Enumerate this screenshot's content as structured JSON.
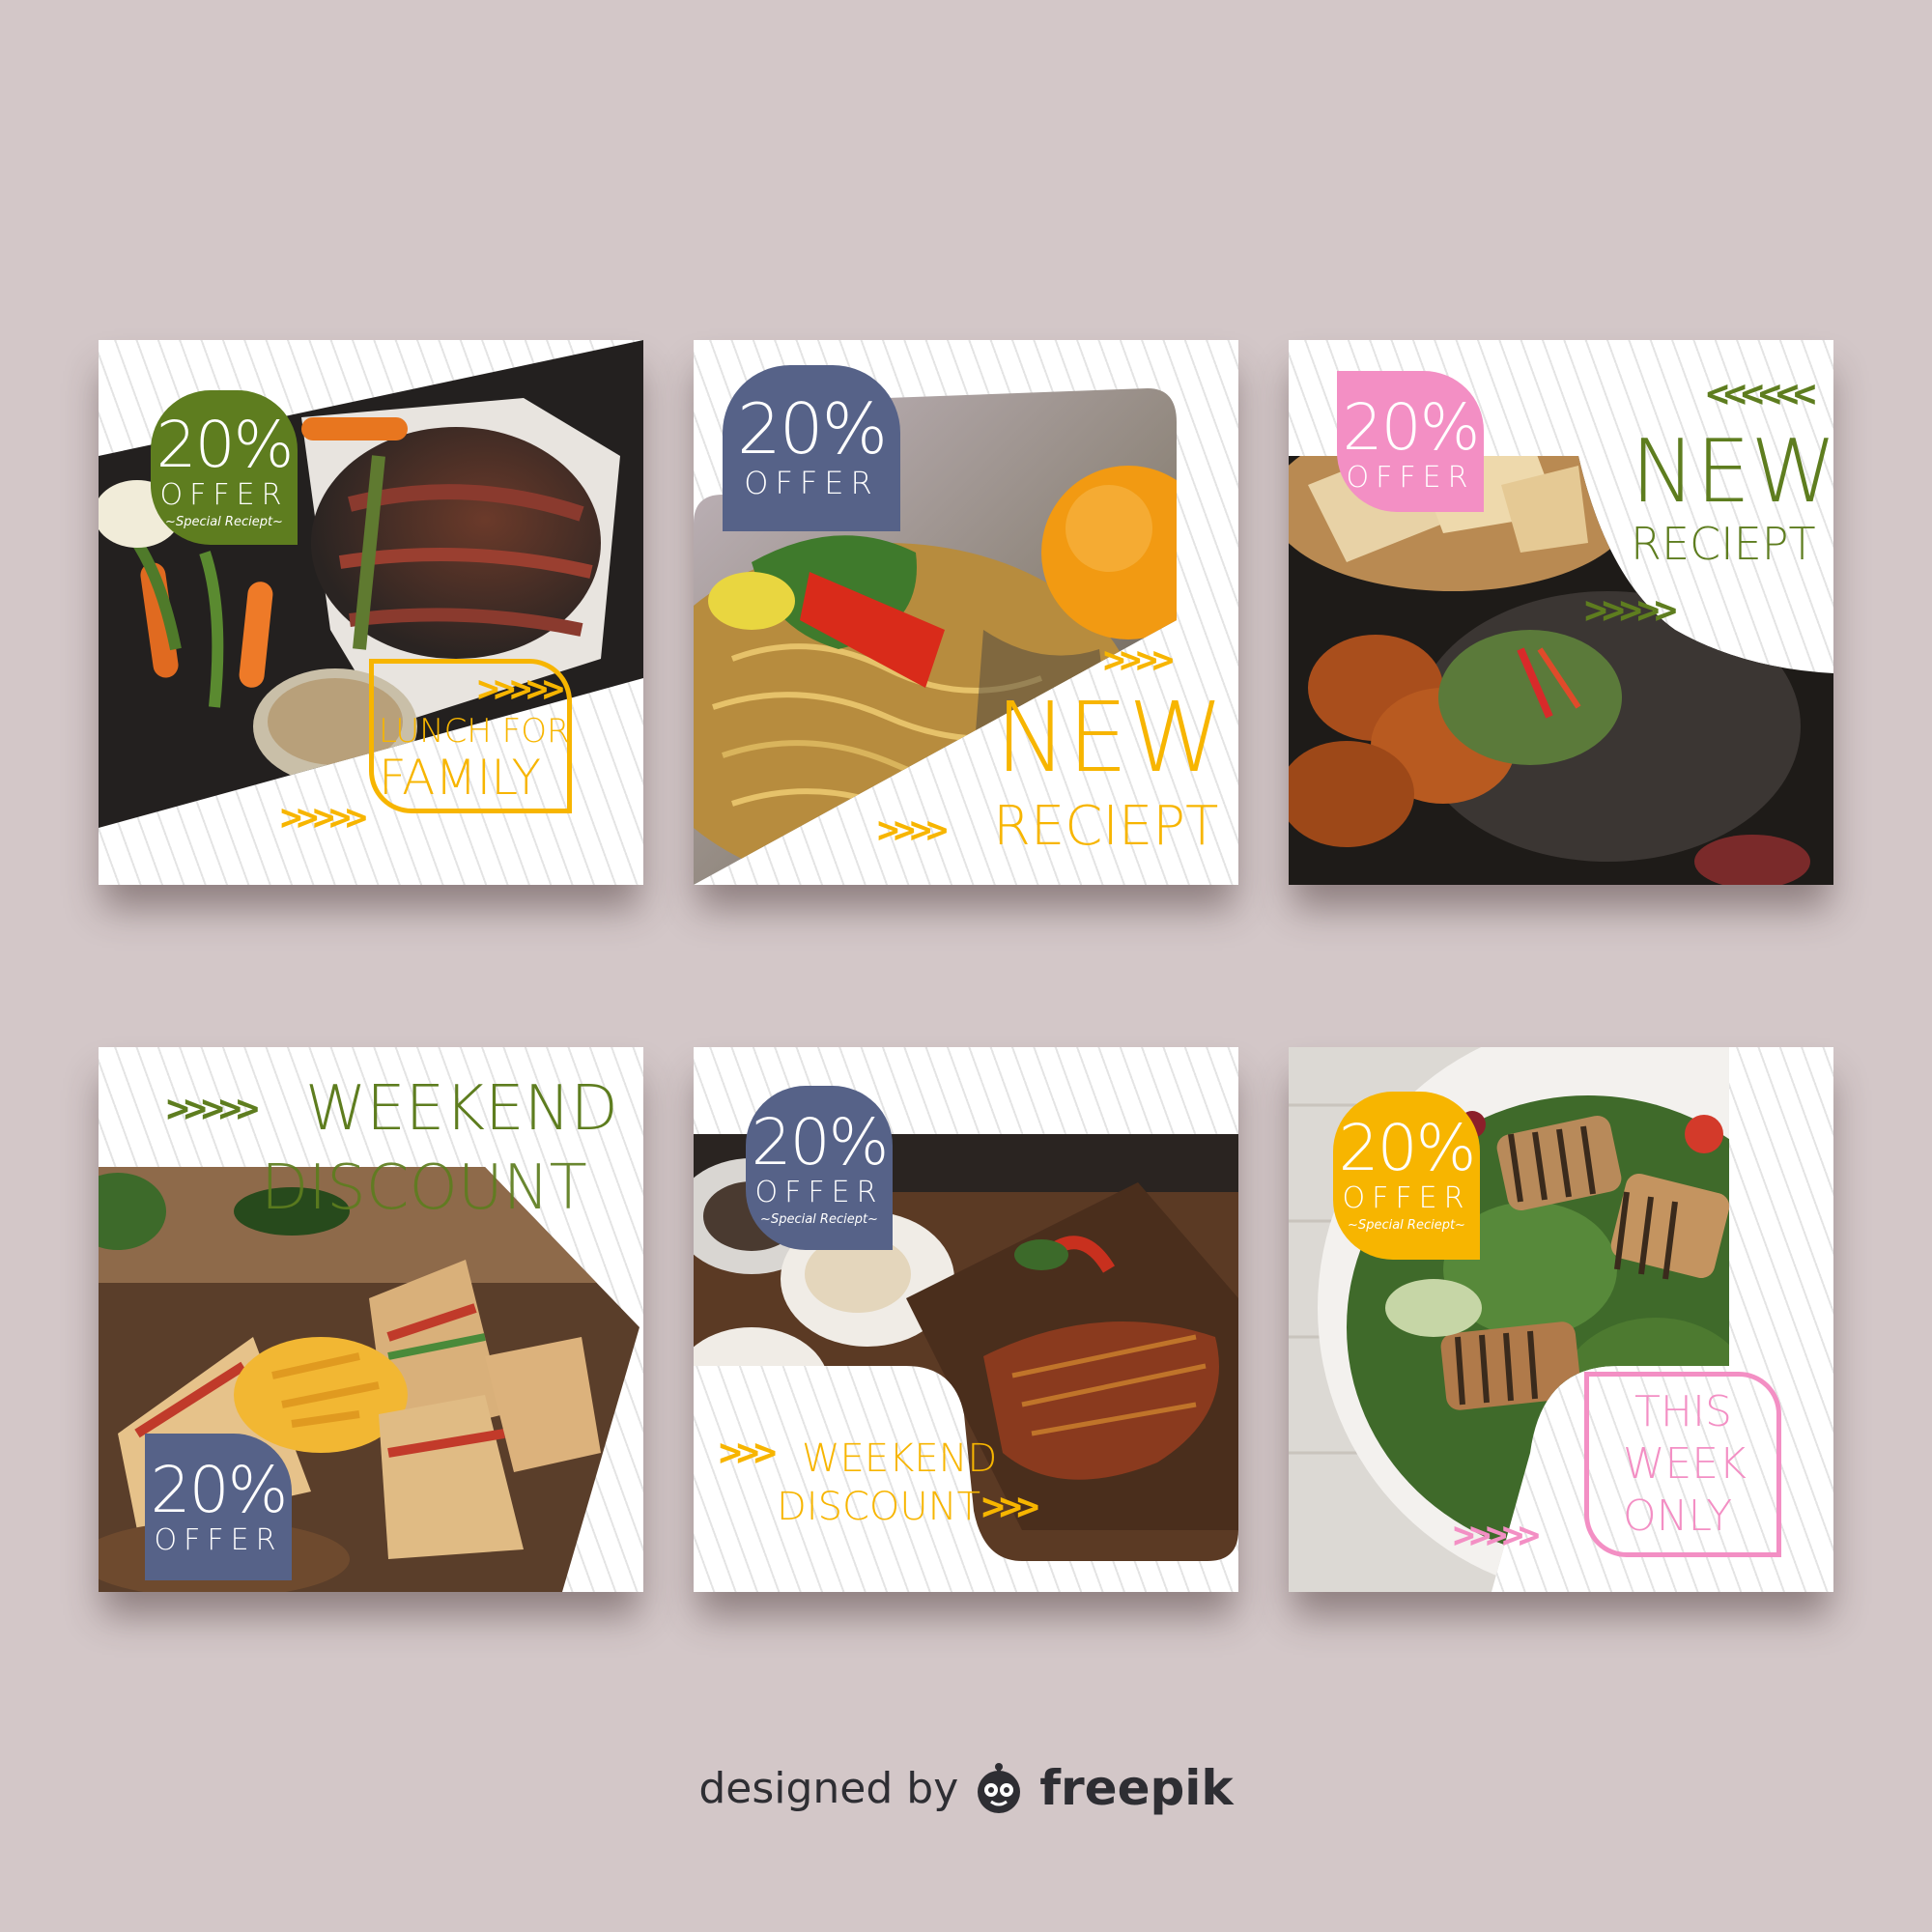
{
  "cards": [
    {
      "badge": {
        "percent": "20%",
        "offer": "OFFER",
        "sub": "~Special Reciept~",
        "color": "#5e7d1f"
      },
      "frame_lines": [
        "LUNCH FOR",
        "FAMILY"
      ],
      "chevrons": [
        ">>>>>",
        ">>>>>"
      ],
      "accent": "#f7b500"
    },
    {
      "badge": {
        "percent": "20%",
        "offer": "OFFER",
        "color": "#566288"
      },
      "headline_1": "NEW",
      "headline_2": "RECIEPT",
      "chevrons": [
        ">>>>",
        ">>>>"
      ],
      "accent": "#f7b500"
    },
    {
      "badge": {
        "percent": "20%",
        "offer": "OFFER",
        "color": "#f38fc4"
      },
      "headline_1": "NEW",
      "headline_2": "RECIEPT",
      "chevrons": [
        "<<<<<<",
        ">>>>>"
      ],
      "accent": "#5e7d1f"
    },
    {
      "badge": {
        "percent": "20%",
        "offer": "OFFER",
        "color": "#566288"
      },
      "headline_1": "WEEKEND",
      "headline_2": "DISCOUNT",
      "chevrons": [
        ">>>>>"
      ],
      "accent": "#5e7d1f"
    },
    {
      "badge": {
        "percent": "20%",
        "offer": "OFFER",
        "sub": "~Special Reciept~",
        "color": "#566288"
      },
      "headline_1": "WEEKEND",
      "headline_2": "DISCOUNT",
      "chevrons": [
        ">>>",
        ">>>"
      ],
      "accent": "#f7b500"
    },
    {
      "badge": {
        "percent": "20%",
        "offer": "OFFER",
        "sub": "~Special Reciept~",
        "color": "#f7b500"
      },
      "frame_lines": [
        "THIS",
        "WEEK",
        "ONLY"
      ],
      "chevrons": [
        ">>>>>"
      ],
      "accent": "#f38fc4"
    }
  ],
  "footer": {
    "designed_by": "designed by",
    "brand": "freepik"
  }
}
